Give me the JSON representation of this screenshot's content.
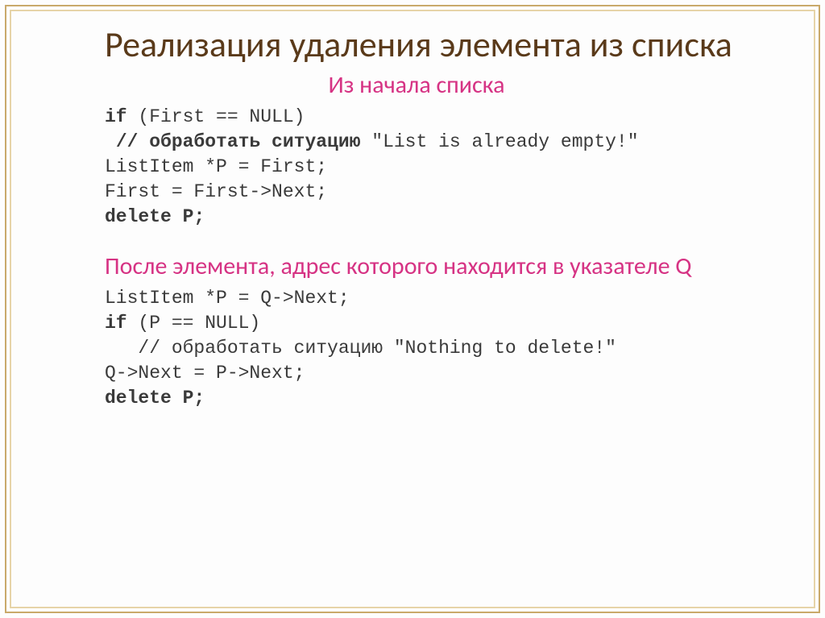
{
  "title": "Реализация удаления элемента из списка",
  "section1": {
    "heading": "Из начала списка",
    "code": "if (First == NULL)\n <b>// обработать ситуацию</b> \"List is already empty!\"\nListItem *P = First;\nFirst = First->Next;\n<b>delete P;</b>"
  },
  "section2": {
    "heading": "После элемента, адрес которого находится в указателе Q",
    "code": "ListItem *P = Q->Next;\n<b>if</b> (P == NULL)\n   // обработать ситуацию \"Nothing to delete!\"\nQ->Next = P->Next;\n<b>delete P;</b>"
  }
}
